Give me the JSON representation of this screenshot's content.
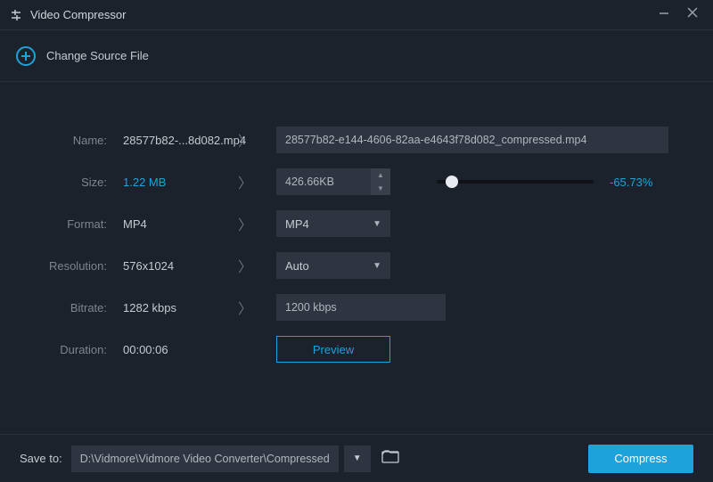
{
  "window": {
    "title": "Video Compressor"
  },
  "change_source": {
    "label": "Change Source File"
  },
  "labels": {
    "name": "Name:",
    "size": "Size:",
    "format": "Format:",
    "resolution": "Resolution:",
    "bitrate": "Bitrate:",
    "duration": "Duration:"
  },
  "source": {
    "name": "28577b82-...8d082.mp4",
    "size": "1.22 MB",
    "format": "MP4",
    "resolution": "576x1024",
    "bitrate": "1282 kbps",
    "duration": "00:00:06"
  },
  "target": {
    "name": "28577b82-e144-4606-82aa-e4643f78d082_compressed.mp4",
    "size": "426.66KB",
    "percent": "-65.73%",
    "format": "MP4",
    "resolution": "Auto",
    "bitrate": "1200 kbps"
  },
  "buttons": {
    "preview": "Preview",
    "compress": "Compress"
  },
  "footer": {
    "saveto_label": "Save to:",
    "saveto_path": "D:\\Vidmore\\Vidmore Video Converter\\Compressed"
  }
}
